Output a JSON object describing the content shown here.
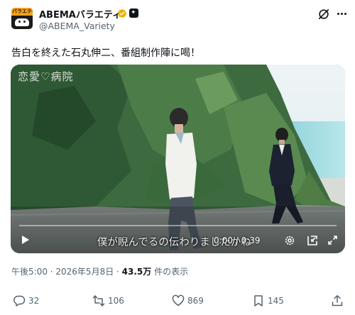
{
  "author": {
    "name": "ABEMAバラエティ",
    "handle": "@ABEMA_Variety",
    "avatar_text": "バラエティ"
  },
  "tweet": {
    "text": "告白を終えた石丸伸二、番組制作陣に喝！"
  },
  "video": {
    "watermark": "恋愛♡病院",
    "subtitle": "僕が睨んでるの伝わりましたかね",
    "time": "0:00 / 0:39",
    "progress": 0
  },
  "meta": {
    "datetime": "午後5:00 · 2026年5月8日 · ",
    "views": "43.5万",
    "views_suffix": " 件の表示"
  },
  "actions": {
    "replies": "32",
    "reposts": "106",
    "likes": "869",
    "bookmarks": "145"
  },
  "colors": {
    "text": "#0f1419",
    "secondary": "#536471",
    "verified": "#e9b10c",
    "brand": "#f7a21b"
  }
}
